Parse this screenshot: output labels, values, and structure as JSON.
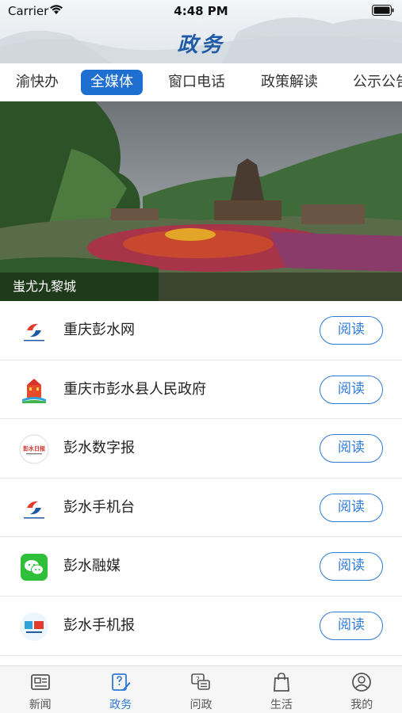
{
  "status_bar": {
    "carrier": "Carrier",
    "time": "4:48 PM"
  },
  "header": {
    "title": "政务"
  },
  "tabs": [
    {
      "label": "渝快办",
      "active": false
    },
    {
      "label": "全媒体",
      "active": true
    },
    {
      "label": "窗口电话",
      "active": false
    },
    {
      "label": "政策解读",
      "active": false
    },
    {
      "label": "公示公告",
      "active": false
    }
  ],
  "banner": {
    "caption": "蚩尤九黎城"
  },
  "list": {
    "action_label": "阅读",
    "items": [
      {
        "name": "重庆彭水网",
        "icon": "pengshui-net-logo"
      },
      {
        "name": "重庆市彭水县人民政府",
        "icon": "government-building-logo"
      },
      {
        "name": "彭水数字报",
        "icon": "pengshui-daily-logo"
      },
      {
        "name": "彭水手机台",
        "icon": "pengshui-mobile-tv-logo"
      },
      {
        "name": "彭水融媒",
        "icon": "wechat-logo"
      },
      {
        "name": "彭水手机报",
        "icon": "pengshui-mobile-news-logo"
      }
    ]
  },
  "tabbar": [
    {
      "label": "新闻",
      "icon": "newspaper-icon",
      "active": false
    },
    {
      "label": "政务",
      "icon": "edit-document-icon",
      "active": true
    },
    {
      "label": "问政",
      "icon": "chat-question-icon",
      "active": false
    },
    {
      "label": "生活",
      "icon": "shopping-bag-icon",
      "active": false
    },
    {
      "label": "我的",
      "icon": "user-icon",
      "active": false
    }
  ],
  "colors": {
    "accent": "#2f79d6",
    "tab_active_bg": "#1f6fd1",
    "title": "#1f5aa6"
  }
}
